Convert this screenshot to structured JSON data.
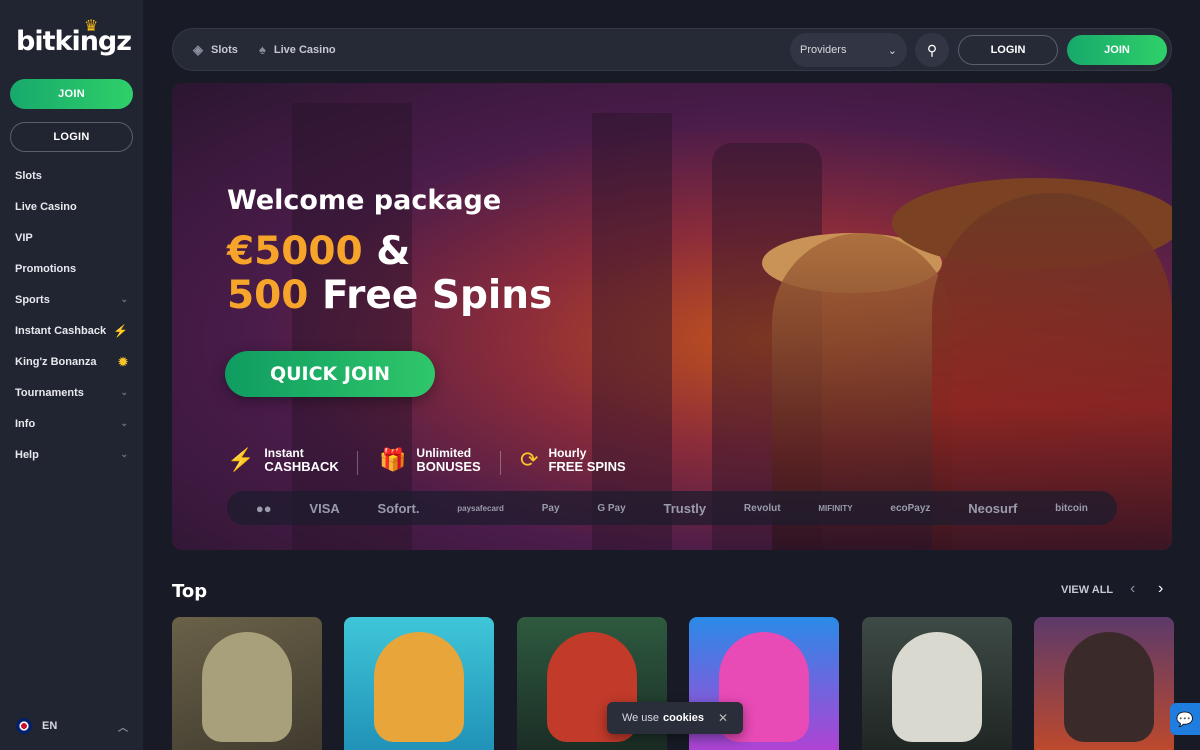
{
  "brand": {
    "name": "bitkingz"
  },
  "sidebar": {
    "join_label": "JOIN",
    "login_label": "LOGIN",
    "items": [
      {
        "label": "Slots"
      },
      {
        "label": "Live Casino"
      },
      {
        "label": "VIP"
      },
      {
        "label": "Promotions"
      },
      {
        "label": "Sports",
        "icon": "chevron-down-icon"
      },
      {
        "label": "Instant Cashback",
        "icon": "bolt-icon"
      },
      {
        "label": "King'z Bonanza",
        "icon": "sun-icon"
      },
      {
        "label": "Tournaments",
        "icon": "chevron-down-icon"
      },
      {
        "label": "Info",
        "icon": "chevron-down-icon"
      },
      {
        "label": "Help",
        "icon": "chevron-down-icon"
      }
    ],
    "language": "EN"
  },
  "topbar": {
    "nav": [
      {
        "label": "Slots",
        "icon": "slots-icon"
      },
      {
        "label": "Live Casino",
        "icon": "live-casino-icon"
      }
    ],
    "providers_label": "Providers",
    "login_label": "LOGIN",
    "join_label": "JOIN"
  },
  "hero": {
    "subtitle": "Welcome package",
    "amount": "€5000",
    "amp": "&",
    "spins_num": "500",
    "spins_text": "Free Spins",
    "cta": "QUICK JOIN",
    "features": [
      {
        "line1": "Instant",
        "line2": "CASHBACK",
        "icon": "bolt-icon"
      },
      {
        "line1": "Unlimited",
        "line2": "BONUSES",
        "icon": "gift-icon"
      },
      {
        "line1": "Hourly",
        "line2": "FREE SPINS",
        "icon": "spin-icon"
      }
    ],
    "payments": [
      "VISA",
      "Sofort.",
      "paysafecard",
      "Pay",
      "G Pay",
      "Trustly",
      "Revolut",
      "MIFINITY",
      "ecoPayz",
      "Neosurf",
      "bitcoin"
    ]
  },
  "top_section": {
    "title": "Top",
    "view_all": "VIEW ALL"
  },
  "cookie": {
    "prefix": "We use",
    "bold": "cookies"
  },
  "colors": {
    "accent_green": "#2fd06a",
    "gold": "#f7a52a",
    "background": "#181b26",
    "sidebar": "#212431"
  }
}
